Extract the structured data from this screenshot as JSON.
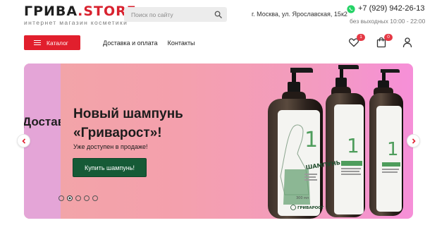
{
  "logo": {
    "main": "ГРИВА",
    "dot": ".",
    "store": "STORE",
    "tagline": "интернет магазин косметики"
  },
  "search": {
    "placeholder": "Поиск по сайту",
    "icon": "search-icon"
  },
  "address": "г. Москва, ул. Ярославская, 15к2",
  "contact": {
    "phone": "+7 (929) 942-26-13",
    "hours": "без выходных 10:00 - 22:00",
    "messenger_icon": "whatsapp-icon"
  },
  "catalog_button": {
    "label": "Каталог",
    "icon": "menu-icon"
  },
  "nav": {
    "items": [
      {
        "label": "Доставка и оплата"
      },
      {
        "label": "Контакты"
      }
    ]
  },
  "header_icons": {
    "favorites": {
      "icon": "heart-icon",
      "count": "1"
    },
    "cart": {
      "icon": "bag-icon",
      "count": "0"
    },
    "account": {
      "icon": "user-icon"
    }
  },
  "hero": {
    "prev_slide_text": "Доставка",
    "title_line1": "Новый шампунь",
    "title_line2": "«Гриварост»!",
    "subtitle": "Уже доступен в продаже!",
    "button_label": "Купить шампунь!",
    "slide_count": 5,
    "active_slide": 2,
    "product": {
      "number": "1",
      "name": "ШАМПУНЬ",
      "brand": "ГРИВАРОСТ",
      "volume": "300 мл"
    }
  },
  "colors": {
    "accent": "#e11f2d",
    "buy_button": "#165a36",
    "badge": "#e53945",
    "hero_start": "#f2a5a7",
    "hero_end": "#f68fd8",
    "whatsapp": "#25d366"
  }
}
